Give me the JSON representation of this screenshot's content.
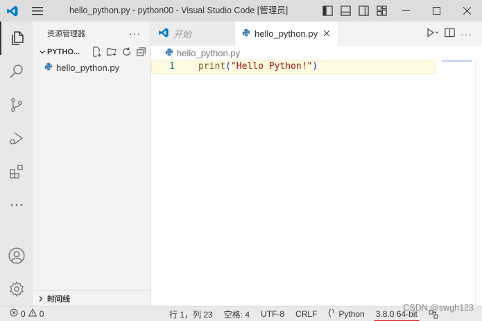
{
  "window": {
    "title": "hello_python.py - python00 - Visual Studio Code [管理员]"
  },
  "sidebar": {
    "header": "资源管理器",
    "more": "···",
    "folder": "PYTHO...",
    "files": [
      "hello_python.py"
    ],
    "timeline": "时间线"
  },
  "tabs": [
    {
      "label": "开始",
      "active": false
    },
    {
      "label": "hello_python.py",
      "active": true
    }
  ],
  "tab_actions": {
    "more": "···"
  },
  "breadcrumb": "hello_python.py",
  "editor": {
    "line_number": "1",
    "code": {
      "fn": "print",
      "open": "(",
      "string": "\"Hello Python!\"",
      "close": ")"
    }
  },
  "statusbar": {
    "errors": "0",
    "warnings": "0",
    "position": "行 1，列 23",
    "spaces": "空格: 4",
    "encoding": "UTF-8",
    "eol": "CRLF",
    "language": "Python",
    "interpreter": "3.8.0 64-bit"
  },
  "watermark": "CSDN @swgh123",
  "colors": {
    "accent_blue": "#007acc",
    "python_blue": "#3572a5",
    "highlight_underline": "#d62020"
  }
}
